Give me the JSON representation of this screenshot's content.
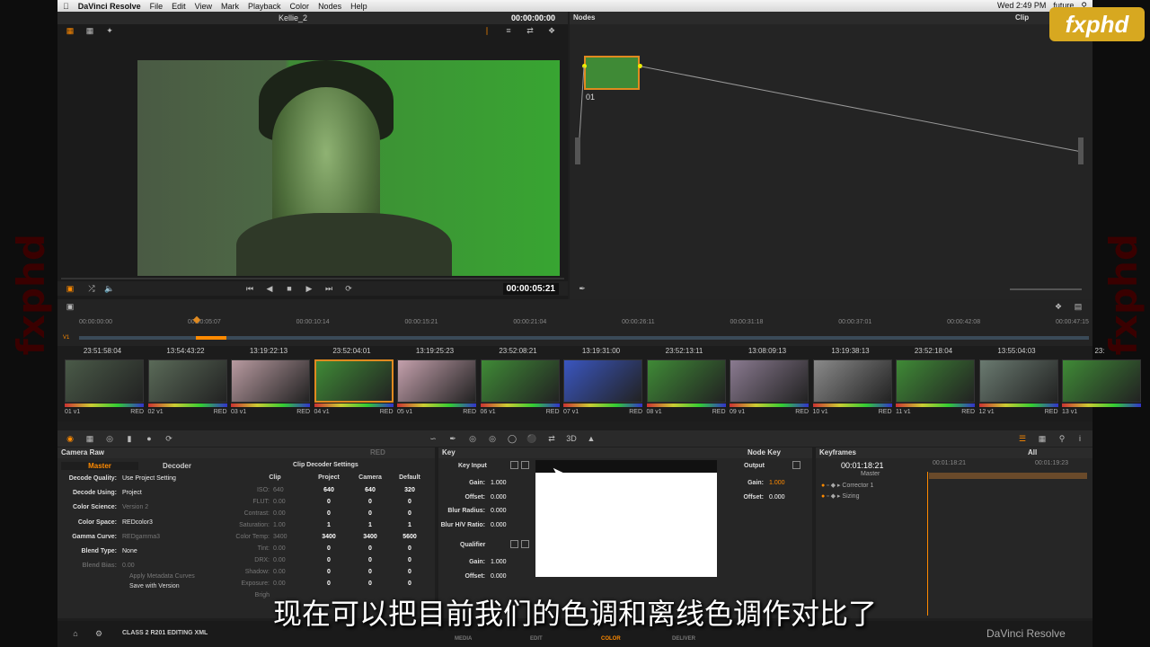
{
  "menubar": {
    "apple": "",
    "app": "DaVinci Resolve",
    "items": [
      "File",
      "Edit",
      "View",
      "Mark",
      "Playback",
      "Color",
      "Nodes",
      "Help"
    ],
    "clock": "Wed 2:49 PM",
    "user": "future"
  },
  "viewer": {
    "clip_name": "Kellie_2",
    "timecode_top": "00:00:00:00",
    "timecode": "00:00:05:21"
  },
  "nodes": {
    "title": "Nodes",
    "mode": "Clip",
    "node_label": "01"
  },
  "timeline": {
    "ruler": [
      "00:00:00:00",
      "00:00:05:07",
      "00:00:10:14",
      "00:00:15:21",
      "00:00:21:04",
      "00:00:26:11",
      "00:00:31:18",
      "00:00:37:01",
      "00:00:42:08",
      "00:00:47:15"
    ],
    "track": "V1"
  },
  "clips": [
    {
      "tc": "23:51:58:04",
      "num": "01",
      "track": "v1",
      "codec": "RED",
      "color": "#4a5a48"
    },
    {
      "tc": "13:54:43:22",
      "num": "02",
      "track": "v1",
      "codec": "RED",
      "color": "#5a6a58"
    },
    {
      "tc": "13:19:22:13",
      "num": "03",
      "track": "v1",
      "codec": "RED",
      "color": "#b89aa0"
    },
    {
      "tc": "23:52:04:01",
      "num": "04",
      "track": "v1",
      "codec": "RED",
      "color": "#3f8a36"
    },
    {
      "tc": "13:19:25:23",
      "num": "05",
      "track": "v1",
      "codec": "RED",
      "color": "#c4a0ac"
    },
    {
      "tc": "23:52:08:21",
      "num": "06",
      "track": "v1",
      "codec": "RED",
      "color": "#3f8a36"
    },
    {
      "tc": "13:19:31:00",
      "num": "07",
      "track": "v1",
      "codec": "RED",
      "color": "#3a56c0"
    },
    {
      "tc": "23:52:13:11",
      "num": "08",
      "track": "v1",
      "codec": "RED",
      "color": "#3f8a36"
    },
    {
      "tc": "13:08:09:13",
      "num": "09",
      "track": "v1",
      "codec": "RED",
      "color": "#8a7a90"
    },
    {
      "tc": "13:19:38:13",
      "num": "10",
      "track": "v1",
      "codec": "RED",
      "color": "#8a8a8a"
    },
    {
      "tc": "23:52:18:04",
      "num": "11",
      "track": "v1",
      "codec": "RED",
      "color": "#3f8a36"
    },
    {
      "tc": "13:55:04:03",
      "num": "12",
      "track": "v1",
      "codec": "RED",
      "color": "#6a7a70"
    },
    {
      "tc": "23:",
      "num": "13",
      "track": "v1",
      "codec": "",
      "color": "#3f8a36"
    }
  ],
  "camera_raw": {
    "title": "Camera Raw",
    "codec": "RED",
    "tabs": [
      "Master",
      "Decoder"
    ],
    "settings": [
      [
        "Decode Quality:",
        "Use Project Setting"
      ],
      [
        "Decode Using:",
        "Project"
      ],
      [
        "Color Science:",
        "Version 2"
      ],
      [
        "Color Space:",
        "REDcolor3"
      ],
      [
        "Gamma Curve:",
        "REDgamma3"
      ],
      [
        "Blend Type:",
        "None"
      ],
      [
        "Blend Bias:",
        "0.00"
      ]
    ],
    "apply_metadata": "Apply Metadata Curves",
    "save_version": "Save with Version",
    "decoder_title": "Clip Decoder Settings",
    "cols": [
      "Clip",
      "Project",
      "Camera",
      "Default"
    ],
    "rows": [
      [
        "ISO:",
        "640",
        "640",
        "640",
        "320"
      ],
      [
        "FLUT:",
        "0.00",
        "0",
        "0",
        "0"
      ],
      [
        "Contrast:",
        "0.00",
        "0",
        "0",
        "0"
      ],
      [
        "Saturation:",
        "1.00",
        "1",
        "1",
        "1"
      ],
      [
        "Color Temp:",
        "3400",
        "3400",
        "3400",
        "5600"
      ],
      [
        "Tint:",
        "0.00",
        "0",
        "0",
        "0"
      ],
      [
        "DRX:",
        "0.00",
        "0",
        "0",
        "0"
      ],
      [
        "Shadow:",
        "0.00",
        "0",
        "0",
        "0"
      ],
      [
        "Exposure:",
        "0.00",
        "0",
        "0",
        "0"
      ],
      [
        "Brigh",
        "",
        "",
        "",
        ""
      ]
    ]
  },
  "key": {
    "title": "Key",
    "node_key": "Node Key",
    "key_input": "Key Input",
    "output": "Output",
    "qualifier": "Qualifier",
    "params": [
      [
        "Gain:",
        "1.000"
      ],
      [
        "Offset:",
        "0.000"
      ],
      [
        "Blur Radius:",
        "0.000"
      ],
      [
        "Blur H/V Ratio:",
        "0.000"
      ]
    ],
    "qparams": [
      [
        "Gain:",
        "1.000"
      ],
      [
        "Offset:",
        "0.000"
      ]
    ],
    "oparams": [
      [
        "Gain:",
        "1.000"
      ],
      [
        "Offset:",
        "0.000"
      ]
    ]
  },
  "keyframes": {
    "title": "Keyframes",
    "filter": "All",
    "tc": "00:01:18:21",
    "ruler": [
      "00:01:18:21",
      "00:01:19:23"
    ],
    "tracks": [
      "Master",
      "Corrector 1",
      "Sizing"
    ]
  },
  "bottom": {
    "project": "CLASS 2 R201 EDITING XML",
    "pages": [
      "MEDIA",
      "EDIT",
      "COLOR",
      "DELIVER"
    ],
    "brand": "DaVinci Resolve"
  },
  "subtitle": "现在可以把目前我们的色调和离线色调作对比了",
  "logo": "fxphd",
  "side_text": "fxphd"
}
